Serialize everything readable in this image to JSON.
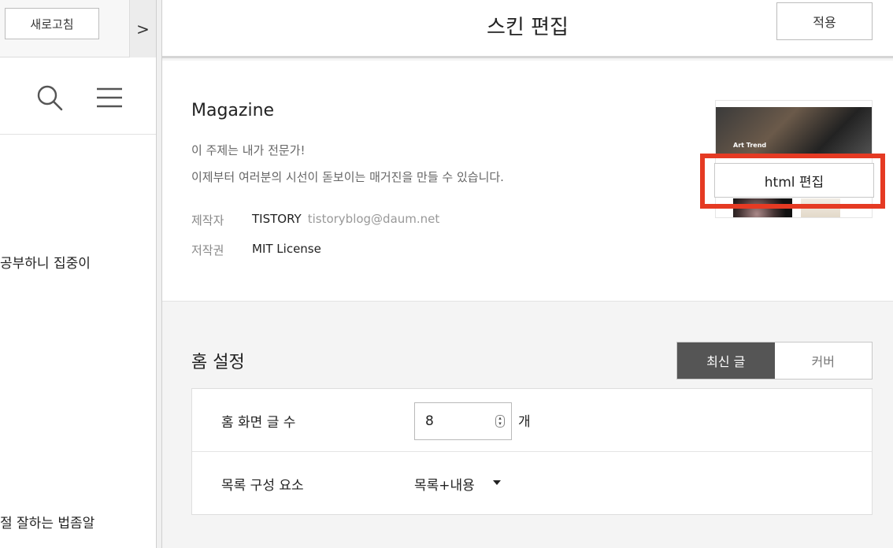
{
  "left_pane": {
    "refresh_label": "새로고침",
    "collapse_glyph": ">",
    "snippets": [
      "공부하니 집중이",
      "절 잘하는 법좀알"
    ]
  },
  "header": {
    "title": "스킨 편집",
    "apply_label": "적용"
  },
  "skin": {
    "name": "Magazine",
    "description_line1": "이 주제는 내가 전문가!",
    "description_line2": "이제부터 여러분의 시선이 돋보이는 매거진을 만들 수 있습니다.",
    "author_label": "제작자",
    "author": "TISTORY",
    "author_email": "tistoryblog@daum.net",
    "license_label": "저작권",
    "license": "MIT License",
    "thumbnail_headline": "Art Trend",
    "html_edit_label": "html 편집",
    "highlight_color": "#e53a23"
  },
  "home_settings": {
    "title": "홈 설정",
    "tabs": [
      {
        "label": "최신 글",
        "active": true
      },
      {
        "label": "커버",
        "active": false
      }
    ],
    "post_count_label": "홈 화면 글 수",
    "post_count_value": "8",
    "post_count_unit": "개",
    "list_items_label": "목록 구성 요소",
    "list_items_value": "목록+내용"
  },
  "icons": [
    "search-icon",
    "menu-icon",
    "chevron-right-icon",
    "caret-down-icon",
    "stepper-icon"
  ]
}
